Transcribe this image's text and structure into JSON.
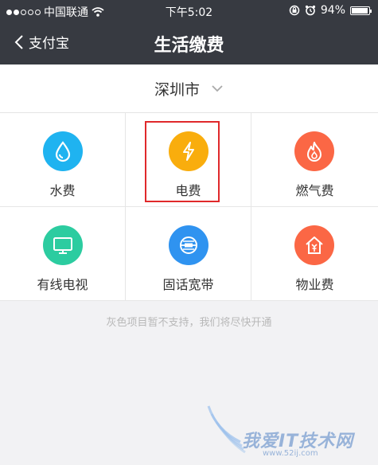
{
  "status_bar": {
    "carrier": "中国联通",
    "time": "下午5:02",
    "battery": "94%",
    "battery_level": 0.94
  },
  "nav": {
    "back_label": "支付宝",
    "title": "生活缴费"
  },
  "city": {
    "name": "深圳市"
  },
  "services": [
    {
      "label": "水费",
      "color": "#1fb3f0",
      "icon": "water-drop-icon"
    },
    {
      "label": "电费",
      "color": "#f9ad0d",
      "icon": "lightning-icon"
    },
    {
      "label": "燃气费",
      "color": "#fb6745",
      "icon": "flame-icon"
    },
    {
      "label": "有线电视",
      "color": "#2ccca0",
      "icon": "tv-icon"
    },
    {
      "label": "固话宽带",
      "color": "#2f93f0",
      "icon": "globe-icon"
    },
    {
      "label": "物业费",
      "color": "#fb6745",
      "icon": "house-icon"
    }
  ],
  "notice": "灰色项目暂不支持，我们将尽快开通",
  "watermark": {
    "text": "我爱IT技术网",
    "url": "www.52ij.com"
  }
}
